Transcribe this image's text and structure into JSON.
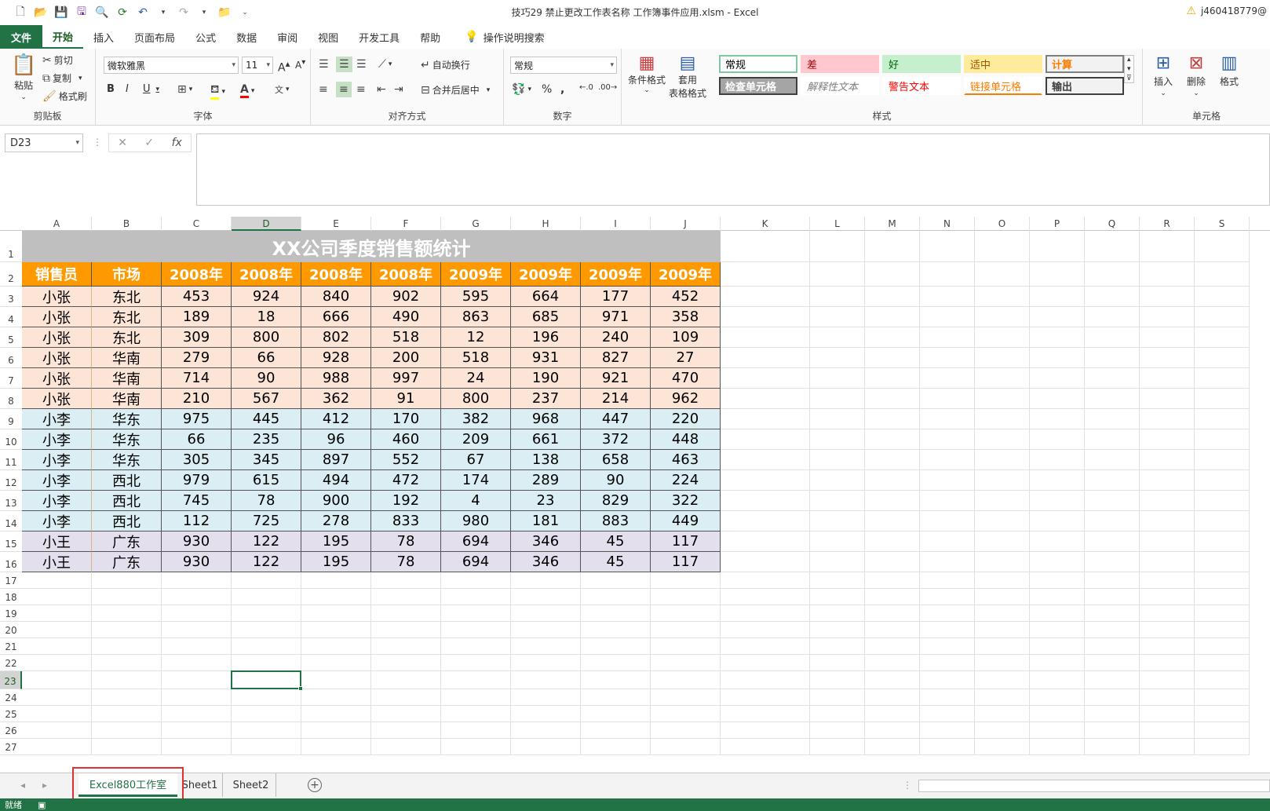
{
  "titlebar": {
    "doc_title": "技巧29  禁止更改工作表名称 工作簿事件应用.xlsm  -  Excel",
    "user": "j460418779@"
  },
  "menu": {
    "file": "文件",
    "tabs": [
      "开始",
      "插入",
      "页面布局",
      "公式",
      "数据",
      "审阅",
      "视图",
      "开发工具",
      "帮助"
    ],
    "search": "操作说明搜索"
  },
  "ribbon": {
    "clipboard": {
      "label": "剪贴板",
      "paste": "粘贴",
      "cut": "剪切",
      "copy": "复制",
      "format_painter": "格式刷"
    },
    "font": {
      "label": "字体",
      "name": "微软雅黑",
      "size": "11",
      "bold": "B",
      "italic": "I",
      "underline": "U"
    },
    "alignment": {
      "label": "对齐方式",
      "wrap": "自动换行",
      "merge": "合并后居中"
    },
    "number": {
      "label": "数字",
      "format": "常规"
    },
    "styles": {
      "label": "样式",
      "conditional": "条件格式",
      "table_format_1": "套用",
      "table_format_2": "表格格式",
      "cells": [
        {
          "text": "常规",
          "bg": "#ffffff",
          "fg": "#000000",
          "border": "#7fc79e"
        },
        {
          "text": "差",
          "bg": "#ffc7ce",
          "fg": "#9c0006",
          "border": "#ffc7ce"
        },
        {
          "text": "好",
          "bg": "#c6efce",
          "fg": "#006100",
          "border": "#c6efce"
        },
        {
          "text": "适中",
          "bg": "#ffeb9c",
          "fg": "#9c5700",
          "border": "#ffeb9c"
        },
        {
          "text": "计算",
          "bg": "#f2f2f2",
          "fg": "#fa7d00",
          "border": "#7f7f7f"
        },
        {
          "text": "检查单元格",
          "bg": "#a5a5a5",
          "fg": "#ffffff",
          "border": "#3f3f3f"
        },
        {
          "text": "解释性文本",
          "bg": "#ffffff",
          "fg": "#7f7f7f",
          "border": "#ffffff"
        },
        {
          "text": "警告文本",
          "bg": "#ffffff",
          "fg": "#ff0000",
          "border": "#ffffff"
        },
        {
          "text": "链接单元格",
          "bg": "#ffffff",
          "fg": "#fa7d00",
          "border": "#ffffff"
        },
        {
          "text": "输出",
          "bg": "#f2f2f2",
          "fg": "#3f3f3f",
          "border": "#3f3f3f"
        }
      ]
    },
    "cells_grp": {
      "label": "单元格",
      "insert": "插入",
      "delete": "删除",
      "format": "格式"
    }
  },
  "formula_bar": {
    "name_box": "D23",
    "fx": "fx"
  },
  "columns": [
    "A",
    "B",
    "C",
    "D",
    "E",
    "F",
    "G",
    "H",
    "I",
    "J",
    "K",
    "L",
    "M",
    "N",
    "O",
    "P",
    "Q",
    "R",
    "S"
  ],
  "rows": [
    "1",
    "2",
    "3",
    "4",
    "5",
    "6",
    "7",
    "8",
    "9",
    "10",
    "11",
    "12",
    "13",
    "14",
    "15",
    "16",
    "17",
    "18",
    "19",
    "20",
    "21",
    "22",
    "23",
    "24",
    "25",
    "26",
    "27"
  ],
  "sheet": {
    "title": "XX公司季度销售额统计",
    "headers": [
      "销售员",
      "市场",
      "2008年",
      "2008年",
      "2008年",
      "2008年",
      "2009年",
      "2009年",
      "2009年",
      "2009年"
    ],
    "data": [
      [
        "小张",
        "东北",
        "453",
        "924",
        "840",
        "902",
        "595",
        "664",
        "177",
        "452"
      ],
      [
        "小张",
        "东北",
        "189",
        "18",
        "666",
        "490",
        "863",
        "685",
        "971",
        "358"
      ],
      [
        "小张",
        "东北",
        "309",
        "800",
        "802",
        "518",
        "12",
        "196",
        "240",
        "109"
      ],
      [
        "小张",
        "华南",
        "279",
        "66",
        "928",
        "200",
        "518",
        "931",
        "827",
        "27"
      ],
      [
        "小张",
        "华南",
        "714",
        "90",
        "988",
        "997",
        "24",
        "190",
        "921",
        "470"
      ],
      [
        "小张",
        "华南",
        "210",
        "567",
        "362",
        "91",
        "800",
        "237",
        "214",
        "962"
      ],
      [
        "小李",
        "华东",
        "975",
        "445",
        "412",
        "170",
        "382",
        "968",
        "447",
        "220"
      ],
      [
        "小李",
        "华东",
        "66",
        "235",
        "96",
        "460",
        "209",
        "661",
        "372",
        "448"
      ],
      [
        "小李",
        "华东",
        "305",
        "345",
        "897",
        "552",
        "67",
        "138",
        "658",
        "463"
      ],
      [
        "小李",
        "西北",
        "979",
        "615",
        "494",
        "472",
        "174",
        "289",
        "90",
        "224"
      ],
      [
        "小李",
        "西北",
        "745",
        "78",
        "900",
        "192",
        "4",
        "23",
        "829",
        "322"
      ],
      [
        "小李",
        "西北",
        "112",
        "725",
        "278",
        "833",
        "980",
        "181",
        "883",
        "449"
      ],
      [
        "小王",
        "广东",
        "930",
        "122",
        "195",
        "78",
        "694",
        "346",
        "45",
        "117"
      ],
      [
        "小王",
        "广东",
        "930",
        "122",
        "195",
        "78",
        "694",
        "346",
        "45",
        "117"
      ]
    ],
    "row_colors": [
      "#fce4d6",
      "#fce4d6",
      "#fce4d6",
      "#fce4d6",
      "#fce4d6",
      "#fce4d6",
      "#daeef3",
      "#daeef3",
      "#daeef3",
      "#daeef3",
      "#daeef3",
      "#daeef3",
      "#e4dfec",
      "#e4dfec"
    ]
  },
  "selected": {
    "column": "D",
    "row": "23"
  },
  "sheet_tabs": [
    "Excel880工作室",
    "Sheet1",
    "Sheet2"
  ],
  "status": {
    "ready": "就绪"
  },
  "colors": {
    "accent": "#217346",
    "header_orange": "#ff9900",
    "title_gray": "#bfbfbf",
    "highlight_red": "#e03030"
  }
}
